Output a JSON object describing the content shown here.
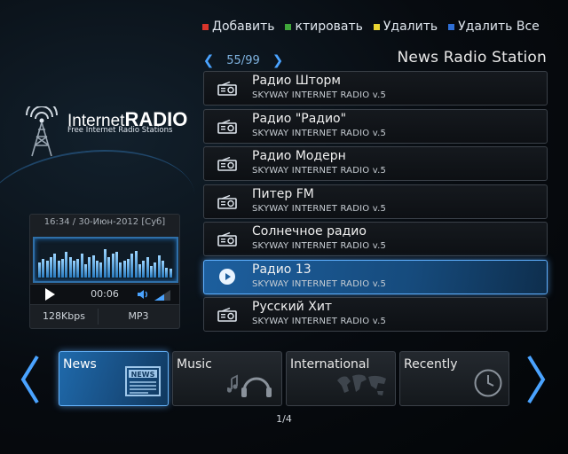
{
  "actions": [
    {
      "label": "Добавить",
      "color": "#d9352b"
    },
    {
      "label": "ктировать",
      "color": "#3fa63a"
    },
    {
      "label": "Удалить",
      "color": "#e9d532"
    },
    {
      "label": "Удалить Все",
      "color": "#2f6fd6"
    }
  ],
  "pager": {
    "current": "55/99"
  },
  "station_title": "News Radio Station",
  "logo": {
    "main_a": "Internet",
    "main_b": "RADIO",
    "sub": "Free Internet Radio Stations"
  },
  "player": {
    "datetime": "16:34 / 30-Июн-2012 [Суб]",
    "elapsed": "00:06",
    "bitrate": "128Kbps",
    "format": "MP3",
    "viz_levels": [
      0.45,
      0.55,
      0.5,
      0.6,
      0.7,
      0.5,
      0.55,
      0.75,
      0.6,
      0.5,
      0.55,
      0.7,
      0.4,
      0.6,
      0.65,
      0.5,
      0.45,
      0.85,
      0.6,
      0.7,
      0.75,
      0.45,
      0.5,
      0.55,
      0.7,
      0.8,
      0.4,
      0.5,
      0.6,
      0.35,
      0.45,
      0.65,
      0.5,
      0.3,
      0.25
    ]
  },
  "stations": [
    {
      "title": "Радио Шторм",
      "sub": "SKYWAY INTERNET RADIO v.5",
      "selected": false
    },
    {
      "title": "Радио \"Радио\"",
      "sub": "SKYWAY INTERNET RADIO v.5",
      "selected": false
    },
    {
      "title": "Радио Модерн",
      "sub": "SKYWAY INTERNET RADIO v.5",
      "selected": false
    },
    {
      "title": "Питер FM",
      "sub": "SKYWAY INTERNET RADIO v.5",
      "selected": false
    },
    {
      "title": "Солнечное радио",
      "sub": "SKYWAY INTERNET RADIO v.5",
      "selected": false
    },
    {
      "title": "Радио 13",
      "sub": "SKYWAY INTERNET RADIO v.5",
      "selected": true
    },
    {
      "title": "Русский Хит",
      "sub": "SKYWAY INTERNET RADIO v.5",
      "selected": false
    }
  ],
  "categories": [
    {
      "label": "News",
      "selected": true,
      "icon": "newspaper-icon",
      "icon_text": "NEWS"
    },
    {
      "label": "Music",
      "selected": false,
      "icon": "headphones-icon"
    },
    {
      "label": "International",
      "selected": false,
      "icon": "world-map-icon"
    },
    {
      "label": "Recently",
      "selected": false,
      "icon": "clock-icon"
    }
  ],
  "category_page": "1/4",
  "colors": {
    "accent": "#4aa3ff",
    "selected_fill": "#1d5f9e",
    "selected_border": "#5fb0ff"
  }
}
